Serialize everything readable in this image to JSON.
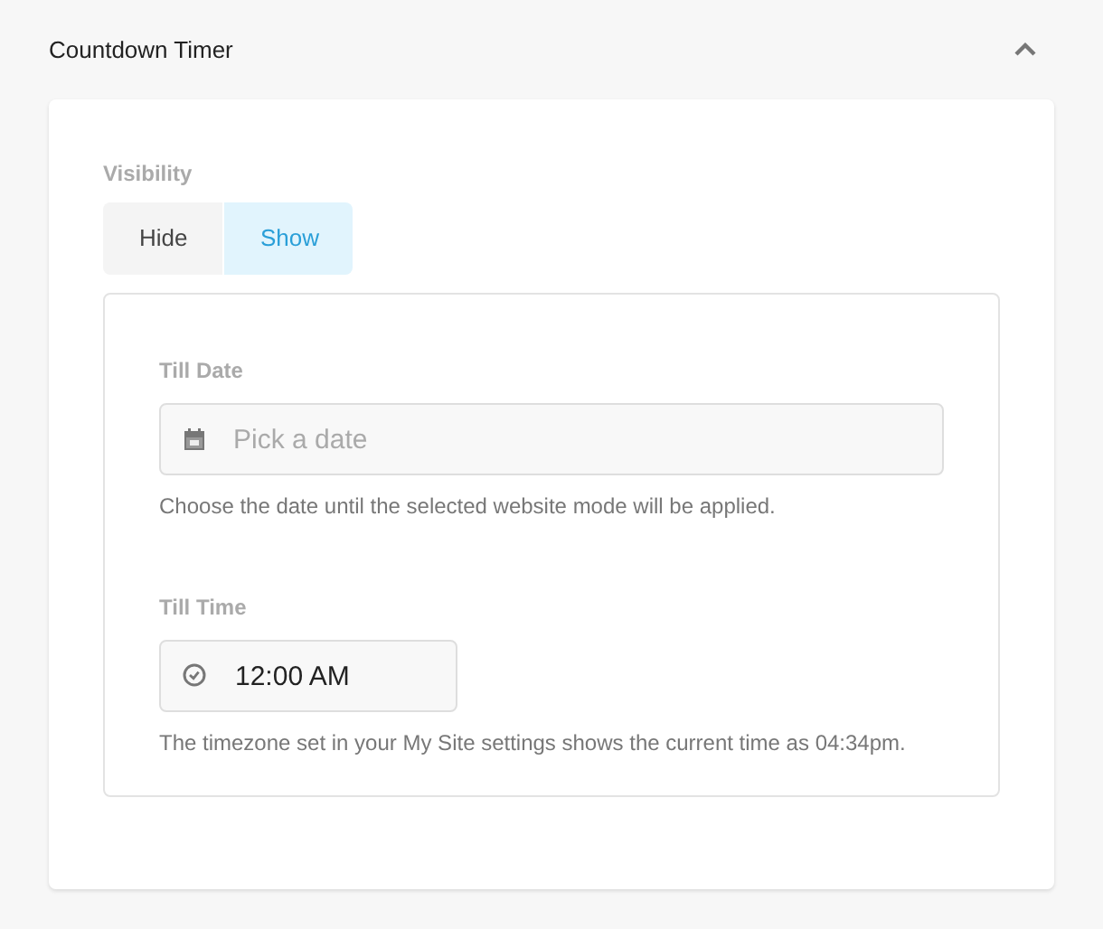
{
  "section": {
    "title": "Countdown Timer",
    "expanded": true
  },
  "visibility": {
    "label": "Visibility",
    "options": [
      {
        "label": "Hide",
        "selected": false
      },
      {
        "label": "Show",
        "selected": true
      }
    ]
  },
  "till_date": {
    "label": "Till Date",
    "placeholder": "Pick a date",
    "help": "Choose the date until the selected website mode will be applied."
  },
  "till_time": {
    "label": "Till Time",
    "value": "12:00 AM",
    "help": "The timezone set in your My Site settings shows the current time as 04:34pm."
  }
}
